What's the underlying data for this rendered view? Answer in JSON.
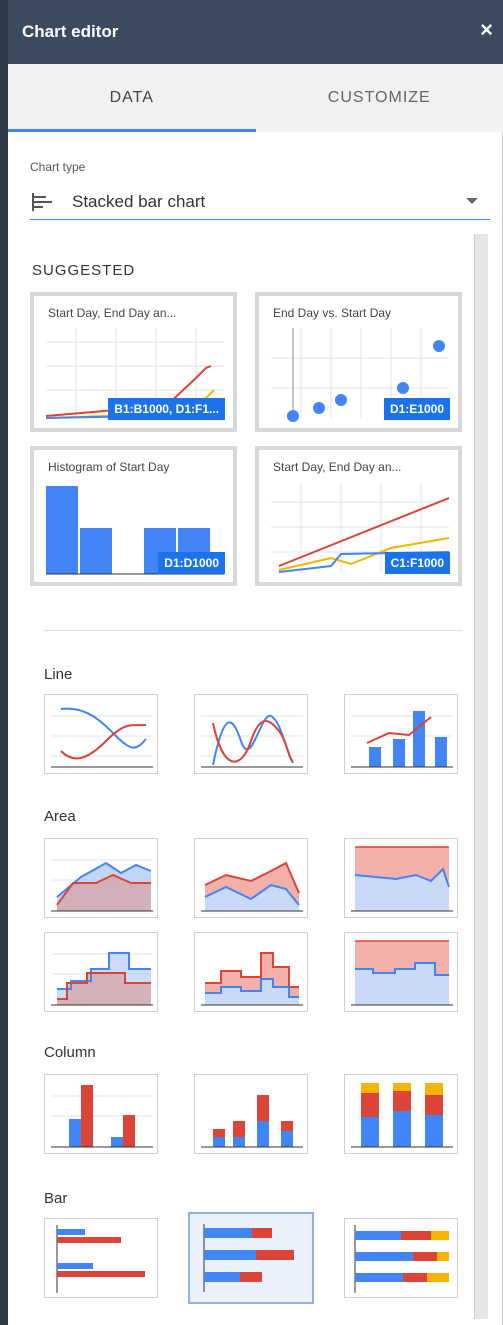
{
  "header": {
    "title": "Chart editor",
    "close_label": "×"
  },
  "tabs": [
    {
      "label": "DATA",
      "active": true
    },
    {
      "label": "CUSTOMIZE",
      "active": false
    }
  ],
  "chart_type": {
    "label": "Chart type",
    "value": "Stacked bar chart",
    "icon": "stacked-bar-icon"
  },
  "suggested": {
    "heading": "SUGGESTED",
    "cards": [
      {
        "caption": "Start Day, End Day an...",
        "range": "B1:B1000, D1:F1...",
        "kind": "line"
      },
      {
        "caption": "End Day vs. Start Day",
        "range": "D1:E1000",
        "kind": "scatter"
      },
      {
        "caption": "Histogram of Start Day",
        "range": "D1:D1000",
        "kind": "histogram"
      },
      {
        "caption": "Start Day, End Day an...",
        "range": "C1:F1000",
        "kind": "line"
      }
    ]
  },
  "categories": [
    {
      "label": "Line"
    },
    {
      "label": "Area"
    },
    {
      "label": "Column"
    },
    {
      "label": "Bar"
    }
  ],
  "colors": {
    "blue": "#4285f4",
    "red": "#db4437",
    "yellow": "#f4b400",
    "accent": "#4285f4",
    "titlebar": "#3b4a5c"
  }
}
